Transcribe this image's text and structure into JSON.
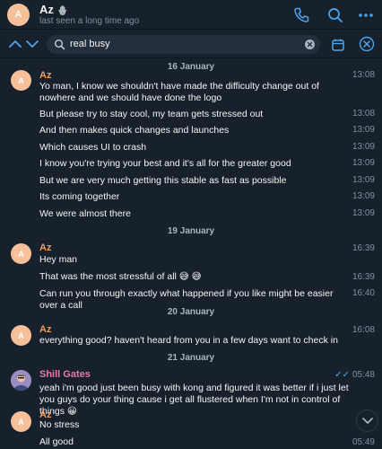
{
  "header": {
    "avatar_initial": "A",
    "name": "Az",
    "name_emoji": "🪬",
    "status": "last seen a long time ago"
  },
  "search": {
    "query": "real busy"
  },
  "colors": {
    "background": "#17212b",
    "accent": "#4fa6f0",
    "sender_orange": "#f19a57",
    "sender_pink": "#e879a8",
    "avatar": "#f5c09a"
  },
  "icons": {
    "phone": "phone-icon",
    "search": "search-icon",
    "more": "more-icon",
    "prev": "chevron-up-icon",
    "next": "chevron-down-icon",
    "calendar": "calendar-icon",
    "close": "close-icon"
  },
  "chat": {
    "date1": "16 January",
    "date2": "19 January",
    "date3": "20 January",
    "date4": "21 January",
    "g1": {
      "avatar": "A",
      "sender": "Az",
      "m1": "Yo man, I know we shouldn't have made the difficulty change out of nowhere and we should have done the logo",
      "t1": "13:08",
      "m2": "But please try to stay cool, my team gets stressed out",
      "t2": "13:08",
      "m3": "And then makes quick changes and launches",
      "t3": "13:09",
      "m4": "Which causes UI to crash",
      "t4": "13:09",
      "m5": "I know you're trying your best and it's all for the greater good",
      "t5": "13:09",
      "m6": "But we are very much getting this stable as fast as possible",
      "t6": "13:09",
      "m7": "Its coming together",
      "t7": "13:09",
      "m8": "We were almost there",
      "t8": "13:09"
    },
    "g2": {
      "avatar": "A",
      "sender": "Az",
      "m1": "Hey man",
      "t1": "16:39",
      "m2": "That was the most stressful of all 😅 😅",
      "t2": "16:39",
      "m3": "Can run you through exactly what happened if you like might be easier over a call",
      "t3": "16:40"
    },
    "g3": {
      "avatar": "A",
      "sender": "Az",
      "m1": "everything good? haven't heard from you in a few days want to check in",
      "t1": "16:08"
    },
    "g4": {
      "sender": "Shill Gates",
      "m1": "yeah i'm good just been busy with kong and figured it was better if i just let you guys do your thing cause i get all flustered when I'm not in control of things 😀",
      "t1": "05:48",
      "ticks": "✓✓"
    },
    "g5": {
      "avatar": "A",
      "sender": "Az",
      "m1": "No stress",
      "m2": "All good",
      "t2": "05:49"
    }
  }
}
